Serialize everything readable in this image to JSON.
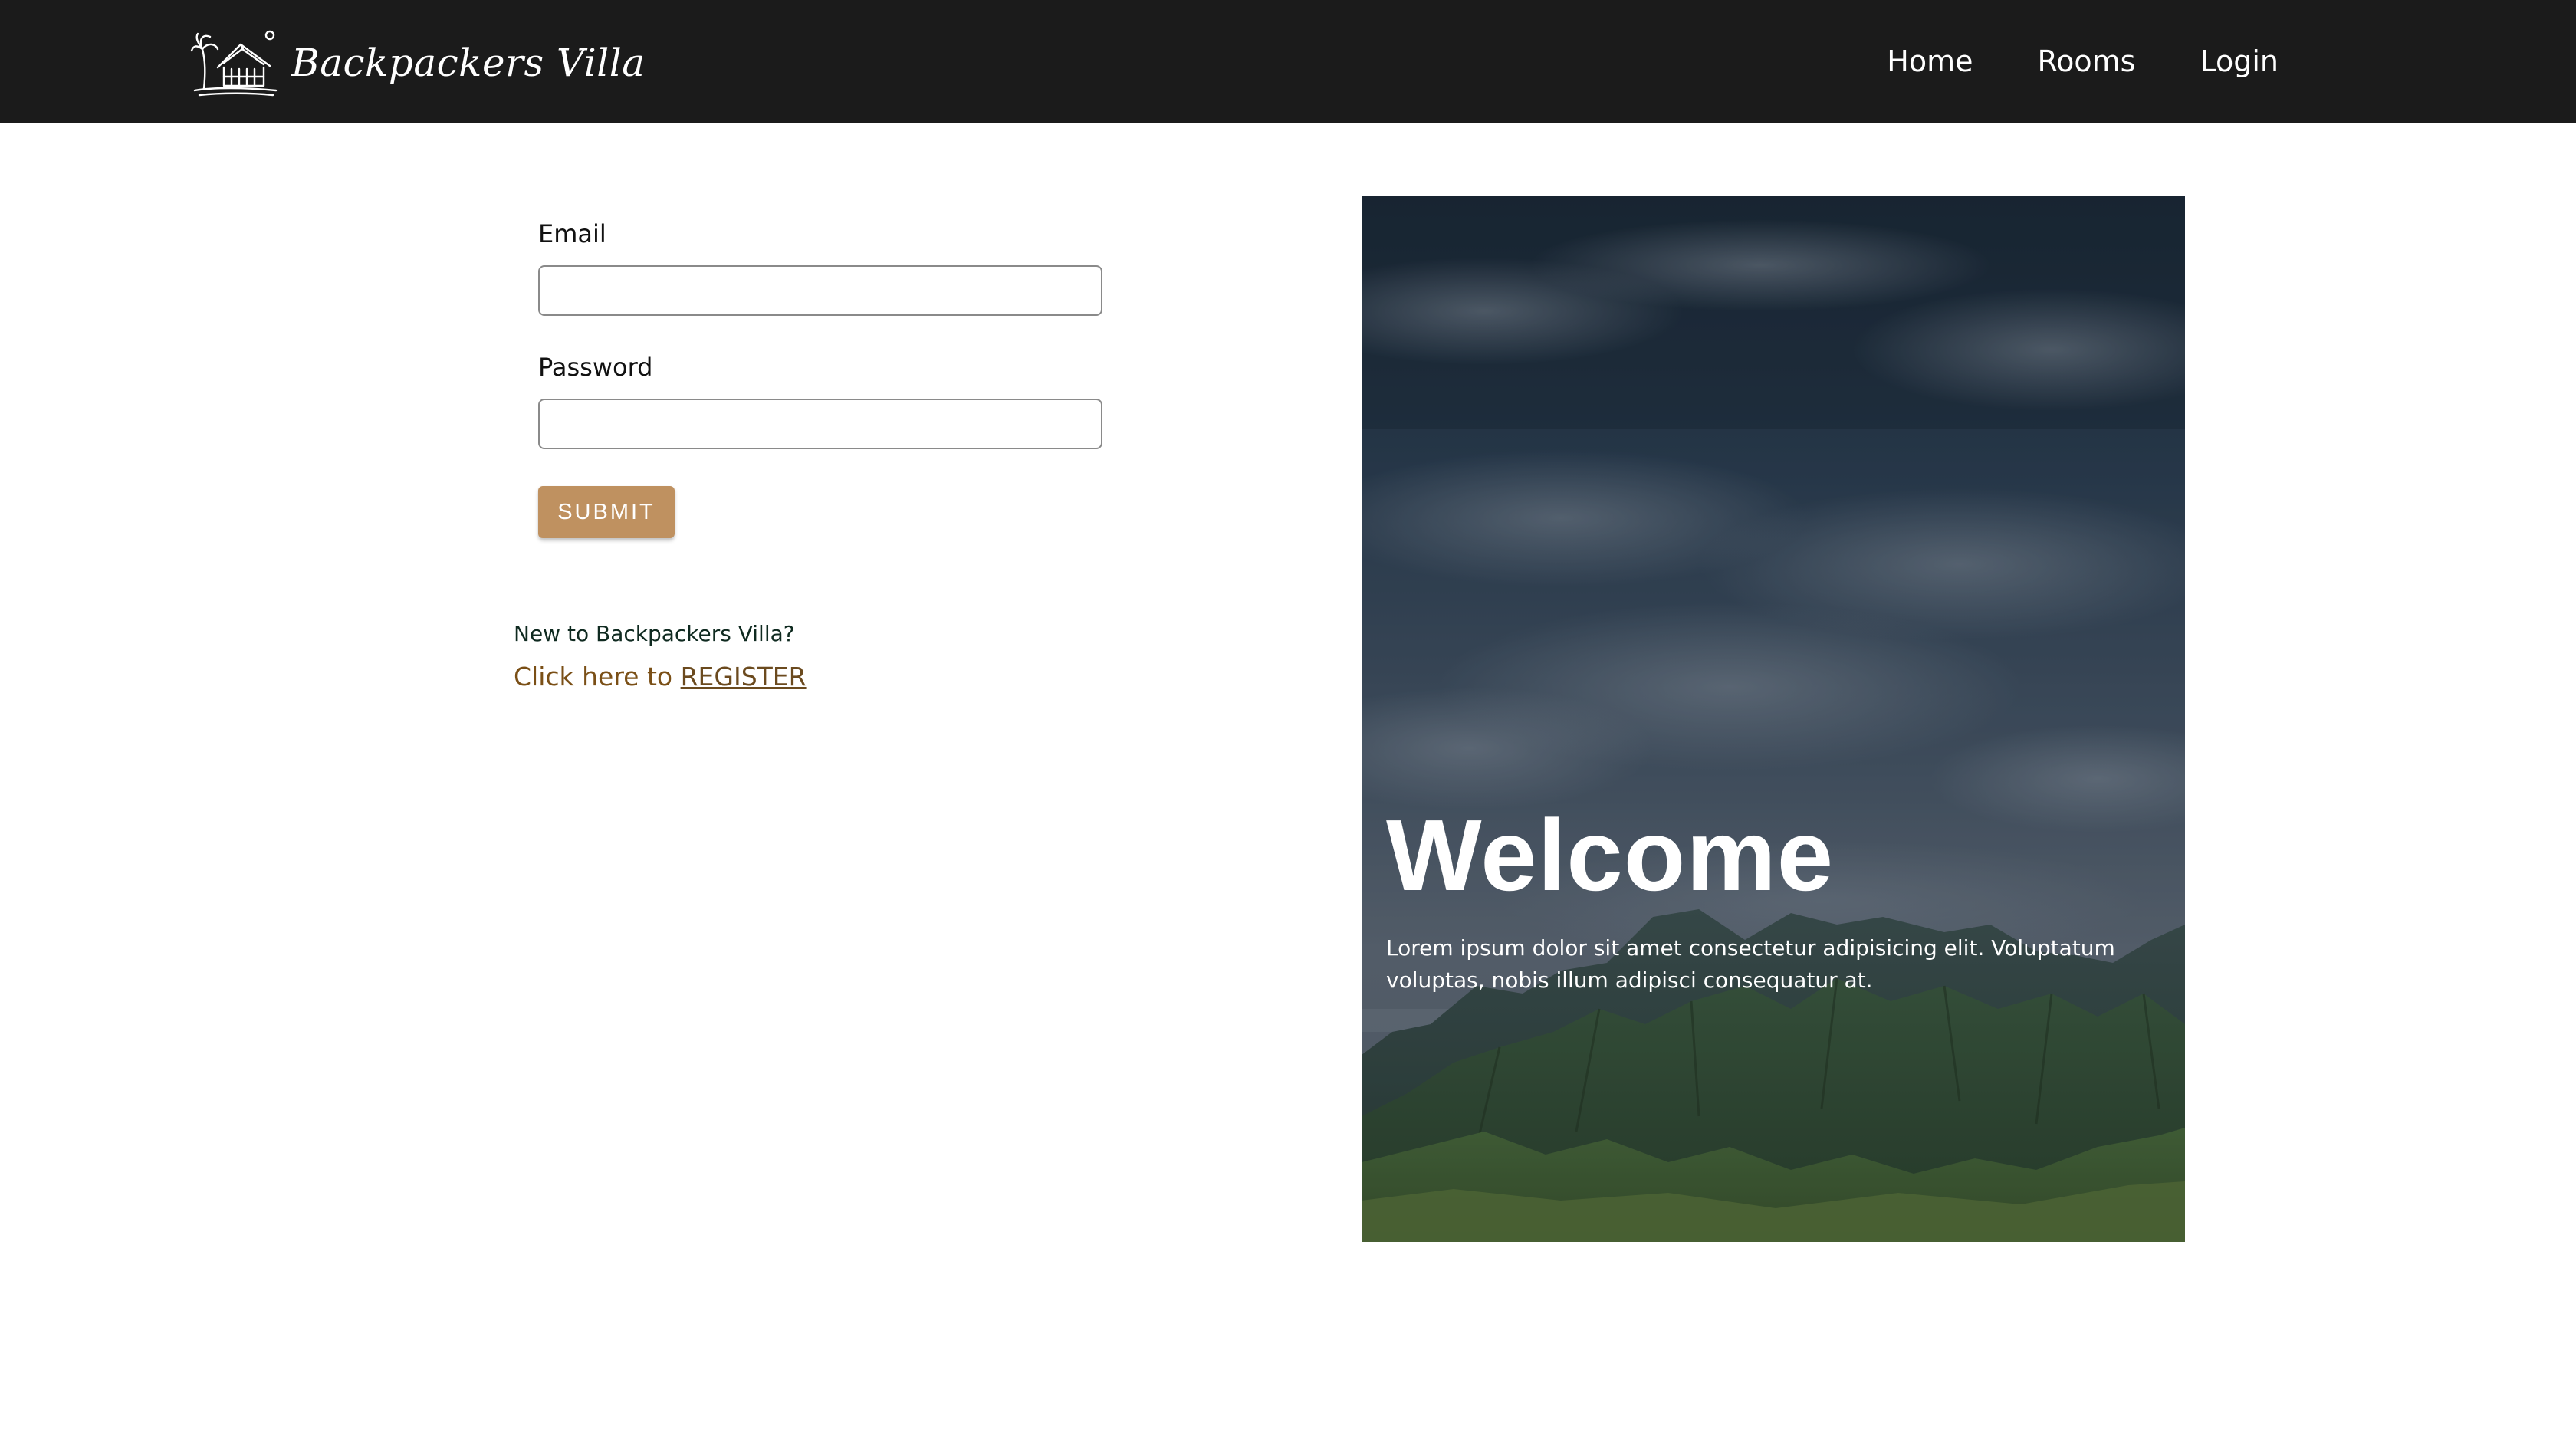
{
  "brand": {
    "name": "Backpackers Villa",
    "logo_icon": "beach-house-palm-logo"
  },
  "nav": {
    "items": [
      {
        "label": "Home"
      },
      {
        "label": "Rooms"
      },
      {
        "label": "Login"
      }
    ]
  },
  "login_form": {
    "email_label": "Email",
    "email_value": "",
    "password_label": "Password",
    "password_value": "",
    "submit_label": "SUBMIT"
  },
  "register": {
    "question": "New to Backpackers Villa?",
    "prompt": "Click here to",
    "link_label": "REGISTER"
  },
  "hero": {
    "title": "Welcome",
    "text": "Lorem ipsum dolor sit amet consectetur adipisicing elit. Voluptatum voluptas, nobis illum adipisci consequatur at.",
    "image_description": "mountain-landscape-photo"
  },
  "colors": {
    "navbar_bg": "#1b1b1b",
    "accent_button": "#bf9160",
    "register_link": "#6b4a1e"
  }
}
